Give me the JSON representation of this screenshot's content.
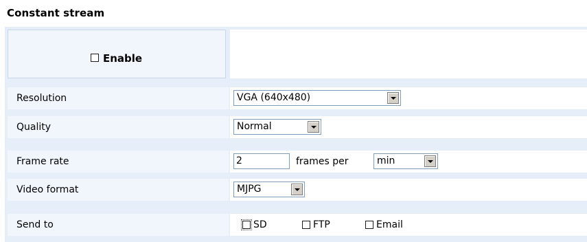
{
  "section": {
    "title": "Constant stream"
  },
  "enable": {
    "label": "Enable",
    "checked": false
  },
  "rows": {
    "resolution": {
      "label": "Resolution",
      "value": "VGA (640x480)"
    },
    "quality": {
      "label": "Quality",
      "value": "Normal"
    },
    "frame_rate": {
      "label": "Frame rate",
      "value": "2",
      "middle_text": "frames per",
      "unit": "min"
    },
    "video_format": {
      "label": "Video format",
      "value": "MJPG"
    },
    "send_to": {
      "label": "Send to",
      "options": {
        "sd": "SD",
        "ftp": "FTP",
        "email": "Email"
      }
    }
  }
}
